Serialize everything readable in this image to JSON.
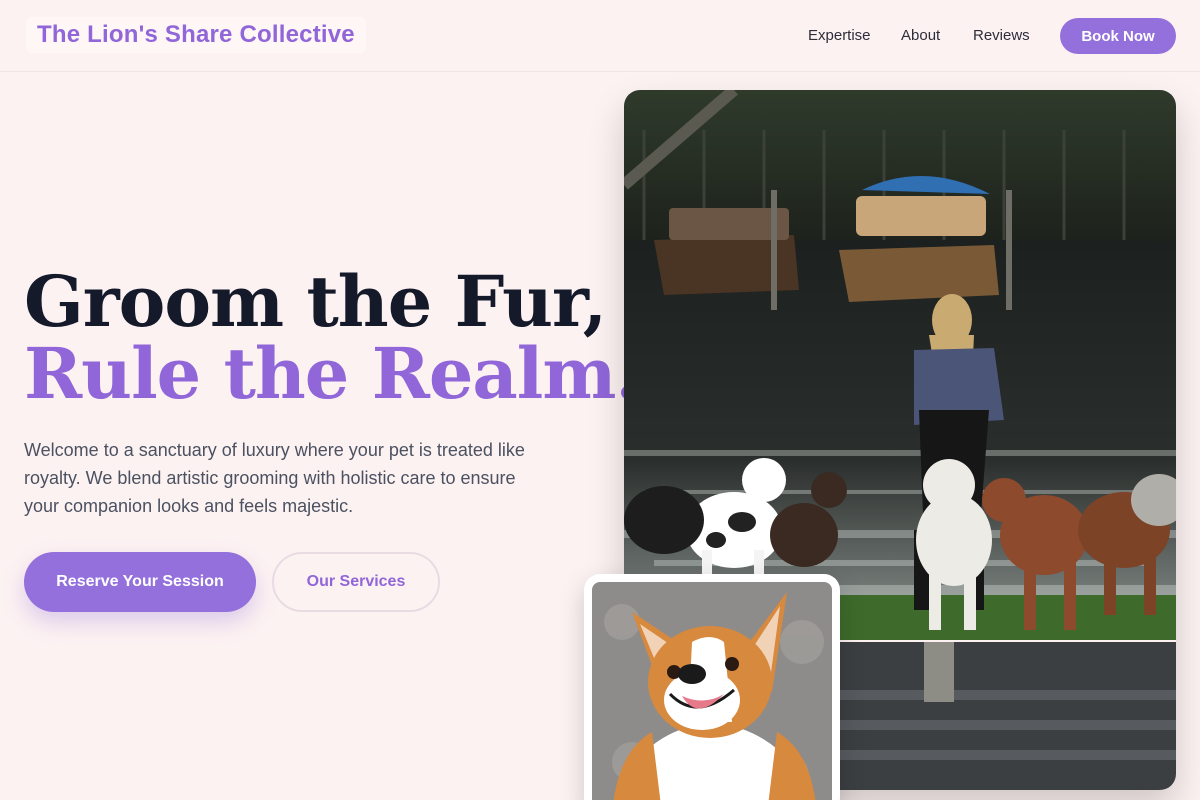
{
  "brand": {
    "name": "The Lion's Share Collective"
  },
  "nav": {
    "items": [
      {
        "label": "Expertise"
      },
      {
        "label": "About"
      },
      {
        "label": "Reviews"
      }
    ],
    "cta_label": "Book Now"
  },
  "hero": {
    "headline_line1": "Groom the Fur,",
    "headline_line2": "Rule the Realm.",
    "description": "Welcome to a sanctuary of luxury where your pet is treated like royalty. We blend artistic grooming with holistic care to ensure your companion looks and feels majestic.",
    "primary_cta": "Reserve Your Session",
    "secondary_cta": "Our Services"
  },
  "images": {
    "main_alt": "Woman walking a pack of dogs by the river with moored boats",
    "inset_alt": "Smiling corgi portrait"
  },
  "colors": {
    "accent": "#9370dc",
    "accent_text": "#9066d8",
    "background": "#fdf2f2",
    "heading": "#141a2a",
    "body_text": "#4b5160"
  }
}
